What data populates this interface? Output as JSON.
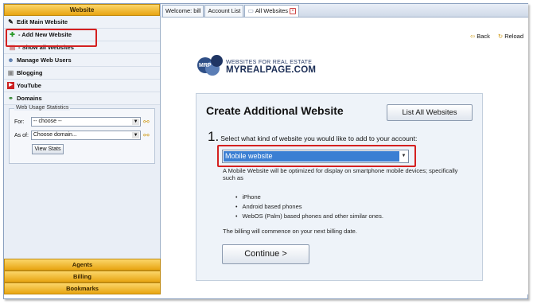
{
  "sidebar": {
    "header": "Website",
    "items": [
      {
        "label": "Edit Main Website",
        "icon": "pencil-icon"
      },
      {
        "label": "- Add New Website",
        "icon": "plus-icon"
      },
      {
        "label": "- Show all Websites",
        "icon": "list-icon"
      },
      {
        "label": "Manage Web Users",
        "icon": "users-icon"
      },
      {
        "label": "Blogging",
        "icon": "blog-icon"
      },
      {
        "label": "YouTube",
        "icon": "youtube-icon"
      },
      {
        "label": "Domains",
        "icon": "domains-icon"
      }
    ],
    "stats": {
      "title": "Web Usage Statistics",
      "for_label": "For:",
      "for_value": "-- choose --",
      "asof_label": "As of:",
      "asof_value": "Choose domain...",
      "button": "View Stats"
    },
    "bottom": [
      "Agents",
      "Billing",
      "Bookmarks"
    ]
  },
  "tabs": [
    {
      "label": "Welcome: bill",
      "active": false
    },
    {
      "label": "Account List",
      "active": false
    },
    {
      "label": "All Websites",
      "active": true
    }
  ],
  "nav": {
    "back": "Back",
    "reload": "Reload"
  },
  "logo": {
    "small": "WEBSITES FOR REAL ESTATE",
    "big": "MYREALPAGE.COM",
    "badge": "MRP"
  },
  "form": {
    "title": "Create Additional Website",
    "list_button": "List All Websites",
    "step_number": "1.",
    "question": "Select what kind of website you would like to add to your account:",
    "selected": "Mobile website",
    "description": "A Mobile Website will be optimized for display on smartphone mobile devices; specifically such as",
    "bullets": [
      "iPhone",
      "Android based phones",
      "WebOS (Palm) based phones and other similar ones."
    ],
    "billing": "The billing will commence on your next billing date.",
    "continue": "Continue >"
  },
  "colors": {
    "accent": "#e8a512",
    "highlight": "#d42020",
    "selection": "#3b7fd3"
  }
}
